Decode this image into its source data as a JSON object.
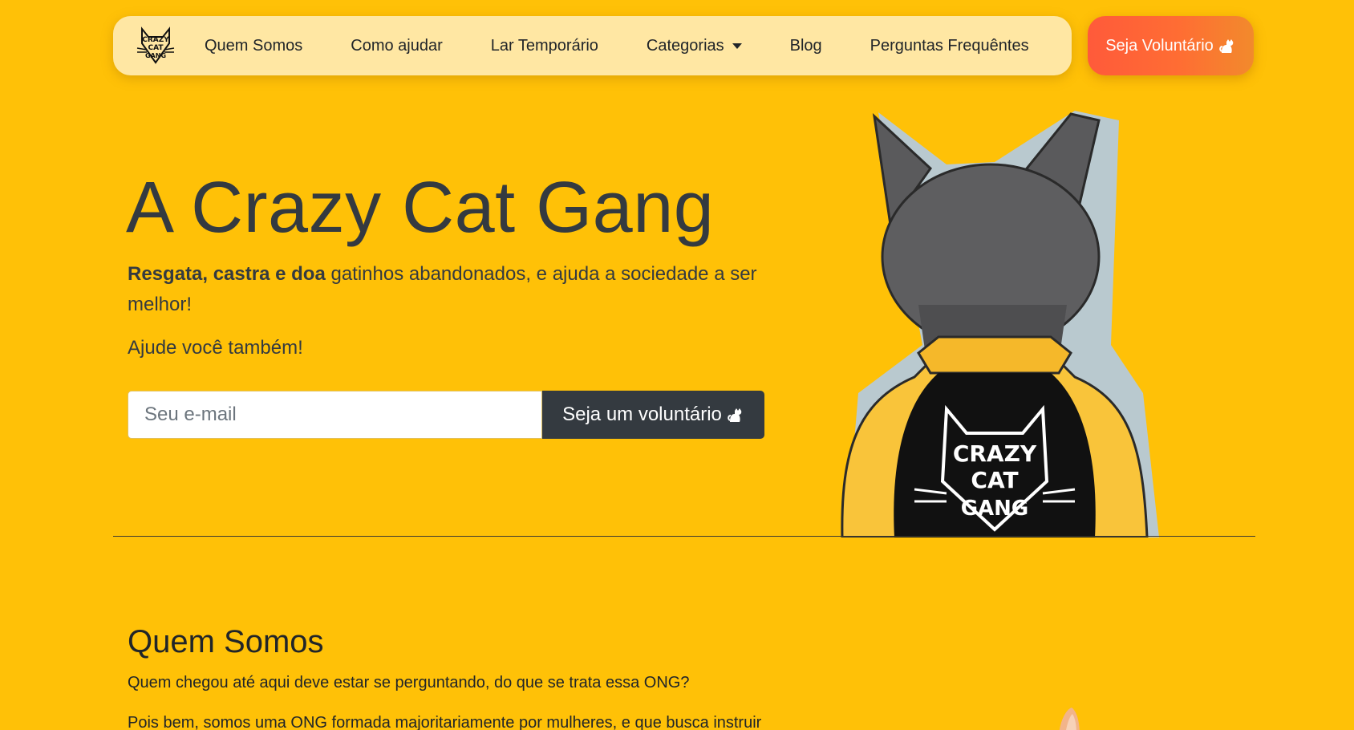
{
  "nav": {
    "brand_alt": "Crazy Cat Gang logo",
    "links": [
      {
        "label": "Quem Somos"
      },
      {
        "label": "Como ajudar"
      },
      {
        "label": "Lar Temporário"
      },
      {
        "label": "Categorias",
        "dropdown": true
      },
      {
        "label": "Blog"
      },
      {
        "label": "Perguntas Frequêntes"
      }
    ],
    "cta_label": "Seja Voluntário"
  },
  "hero": {
    "title": "A Crazy Cat Gang",
    "lead_bold": "Resgata, castra e doa",
    "lead_rest": " gatinhos abandonados, e ajuda a sociedade a ser melhor!",
    "help_text": "Ajude você também!",
    "email_placeholder": "Seu e-mail",
    "submit_label": "Seja um voluntário"
  },
  "about": {
    "title": "Quem Somos",
    "p1": "Quem chegou até aqui deve estar se perguntando, do que se trata essa ONG?",
    "p2": "Pois bem, somos uma ONG formada majoritariamente por mulheres, e que busca instruir"
  },
  "colors": {
    "background": "#ffc107",
    "navbar": "#ffe7a3",
    "cta_gradient_start": "#ff5a3a",
    "cta_gradient_end": "#f28a2c",
    "dark": "#343a40"
  },
  "icons": [
    "crazy-cat-gang-logo",
    "cat-icon",
    "caret-down-icon"
  ]
}
